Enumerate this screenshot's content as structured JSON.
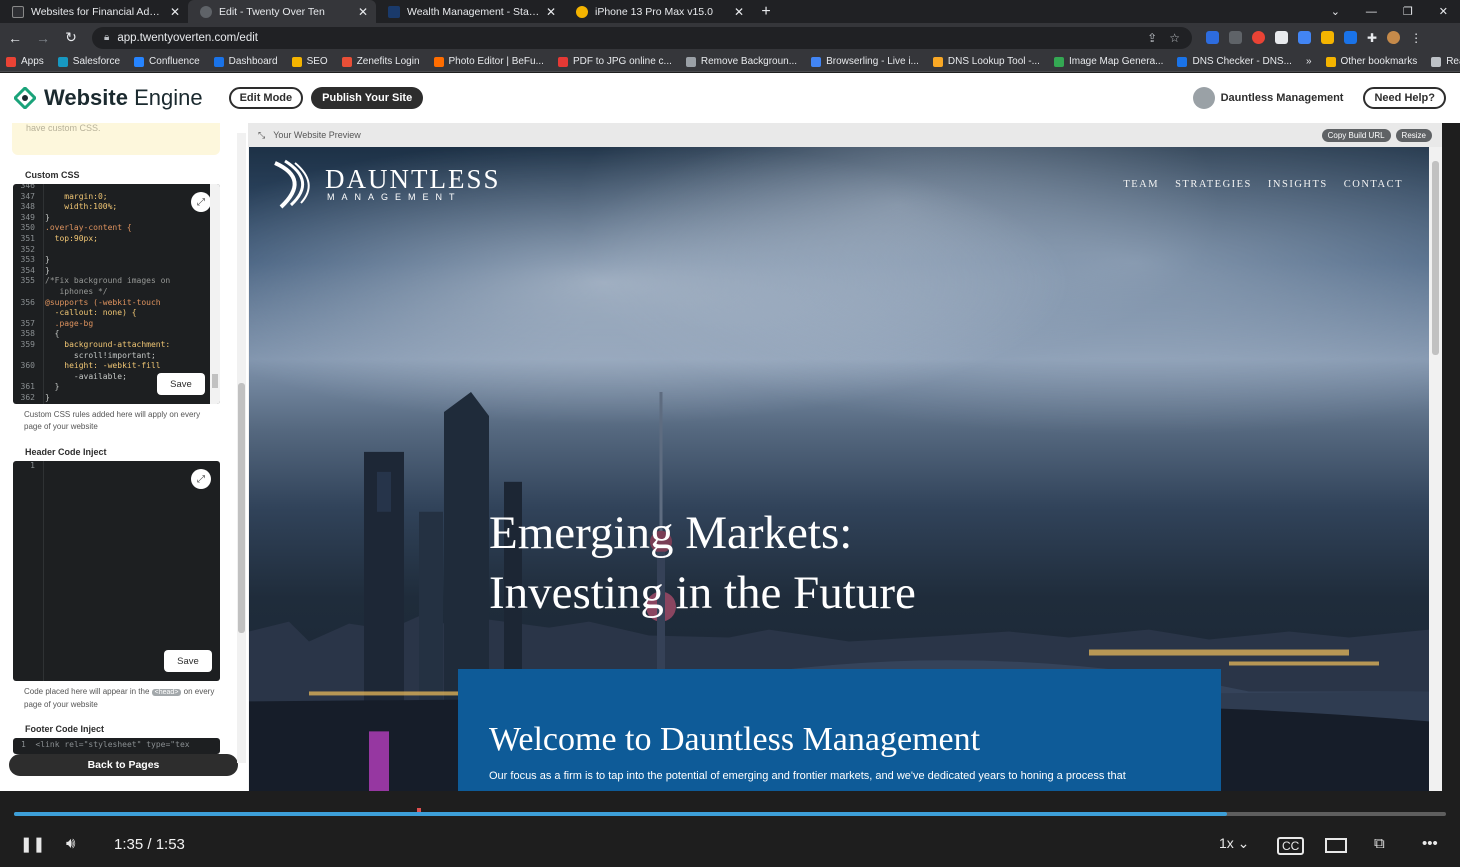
{
  "browser": {
    "tabs": [
      {
        "title": "Websites for Financial Advisors -",
        "favicon_color": "#2e2f33",
        "active": false
      },
      {
        "title": "Edit - Twenty Over Ten",
        "favicon_color": "#5f6368",
        "active": true
      },
      {
        "title": "Wealth Management - Stamford,",
        "favicon_color": "#1a73e8",
        "active": false
      },
      {
        "title": "iPhone 13 Pro Max v15.0",
        "favicon_color": "#f4b400",
        "active": false
      }
    ],
    "url": "app.twentyoverten.com/edit",
    "bookmarks": [
      {
        "label": "Apps",
        "color": "#ea4335"
      },
      {
        "label": "Salesforce",
        "color": "#1798c1"
      },
      {
        "label": "Confluence",
        "color": "#2684ff"
      },
      {
        "label": "Dashboard",
        "color": "#1a73e8"
      },
      {
        "label": "SEO",
        "color": "#f4b400"
      },
      {
        "label": "Zenefits Login",
        "color": "#e94f37"
      },
      {
        "label": "Photo Editor | BeFu...",
        "color": "#ff6d00"
      },
      {
        "label": "PDF to JPG online c...",
        "color": "#e53935"
      },
      {
        "label": "Remove Backgroun...",
        "color": "#9aa0a6"
      },
      {
        "label": "Browserling - Live i...",
        "color": "#4285f4"
      },
      {
        "label": "DNS Lookup Tool -...",
        "color": "#f9a825"
      },
      {
        "label": "Image Map Genera...",
        "color": "#34a853"
      },
      {
        "label": "DNS Checker - DNS...",
        "color": "#1a73e8"
      }
    ],
    "bookmarks_right": [
      {
        "label": "Other bookmarks",
        "color": "#f4b400"
      },
      {
        "label": "Reading list",
        "color": "#bdc1c6"
      }
    ]
  },
  "header": {
    "logo_bold": "Website",
    "logo_light": "Engine",
    "edit_mode": "Edit Mode",
    "publish": "Publish Your Site",
    "account": "Dauntless Management",
    "help": "Need Help?"
  },
  "sidebar": {
    "hint": "have custom CSS.",
    "custom_css_label": "Custom CSS",
    "css_lines": [
      {
        "n": "346",
        "t": ""
      },
      {
        "n": "347",
        "t": "    margin:0;"
      },
      {
        "n": "348",
        "t": "    width:100%;"
      },
      {
        "n": "349",
        "t": "}"
      },
      {
        "n": "350",
        "t": ".overlay-content {"
      },
      {
        "n": "351",
        "t": "  top:90px;"
      },
      {
        "n": "352",
        "t": ""
      },
      {
        "n": "353",
        "t": "}"
      },
      {
        "n": "354",
        "t": "}"
      },
      {
        "n": "355",
        "t": "/*Fix background images on"
      },
      {
        "n": "",
        "t": "   iphones */"
      },
      {
        "n": "356",
        "t": "@supports (-webkit-touch"
      },
      {
        "n": "",
        "t": "  -callout: none) {"
      },
      {
        "n": "357",
        "t": "  .page-bg"
      },
      {
        "n": "358",
        "t": "  {"
      },
      {
        "n": "359",
        "t": "    background-attachment:"
      },
      {
        "n": "",
        "t": "      scroll!important;"
      },
      {
        "n": "360",
        "t": "    height: -webkit-fill"
      },
      {
        "n": "",
        "t": "      -available;"
      },
      {
        "n": "361",
        "t": "  }"
      },
      {
        "n": "362",
        "t": "}"
      }
    ],
    "save_label": "Save",
    "css_note": "Custom CSS rules added here will apply on every page of your website",
    "header_inject_label": "Header Code Inject",
    "header_line": "1",
    "header_note_pre": "Code placed here will appear in the",
    "header_note_tag": "<head>",
    "header_note_post": "on every page of your website",
    "footer_inject_label": "Footer Code Inject",
    "footer_line": "1  <link rel=\"stylesheet\" type=\"tex",
    "back": "Back to Pages"
  },
  "preview": {
    "label": "Your Website Preview",
    "copy_url": "Copy Build URL",
    "resize": "Resize",
    "site_name": "DAUNTLESS",
    "site_sub": "MANAGEMENT",
    "nav": [
      "TEAM",
      "STRATEGIES",
      "INSIGHTS",
      "CONTACT"
    ],
    "hero_line1": "Emerging Markets:",
    "hero_line2": "Investing in the Future",
    "welcome": "Welcome to Dauntless Management",
    "welcome_body": "Our focus as a firm is to tap into the potential of emerging and frontier markets, and we've dedicated years to honing a process that"
  },
  "player": {
    "time": "1:35 / 1:53",
    "progress": 0.847,
    "speed": "1x"
  }
}
